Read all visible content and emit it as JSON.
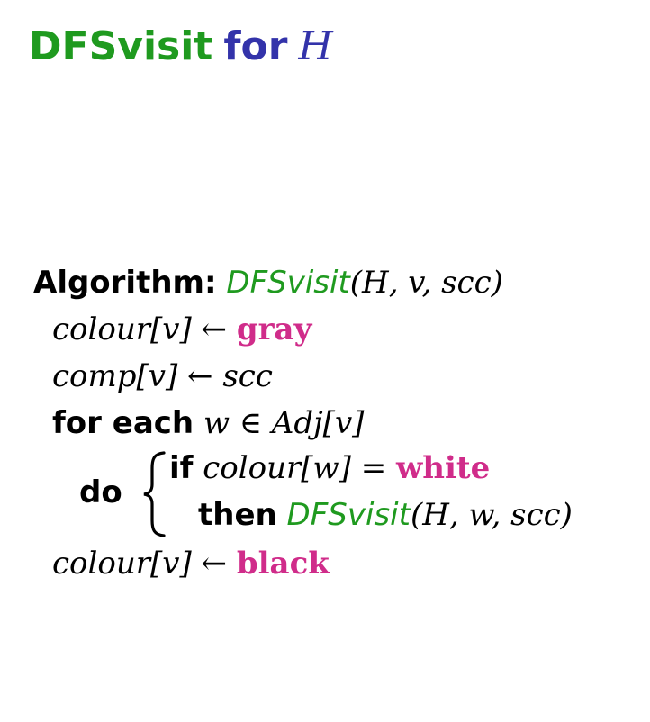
{
  "title": {
    "part1": "DFSvisit",
    "part2": "for",
    "part3": "H"
  },
  "algorithm": {
    "label": "Algorithm:",
    "name": "DFSvisit",
    "params": "(H, v, scc)",
    "line1": {
      "lhs": "colour[v] ← ",
      "value": "gray"
    },
    "line2": {
      "text": "comp[v] ← scc"
    },
    "line3": {
      "keyword": "for each",
      "expr": "w ∈ Adj[v]"
    },
    "loop": {
      "do_keyword": "do",
      "if_keyword": "if",
      "if_expr": "colour[w] = ",
      "if_value": "white",
      "then_keyword": "then",
      "then_call": "DFSvisit",
      "then_args": "(H, w, scc)"
    },
    "line5": {
      "lhs": "colour[v] ← ",
      "value": "black"
    }
  },
  "colors": {
    "function_green": "#1f9a1f",
    "title_blue": "#3333aa",
    "value_magenta": "#d02c8a"
  }
}
